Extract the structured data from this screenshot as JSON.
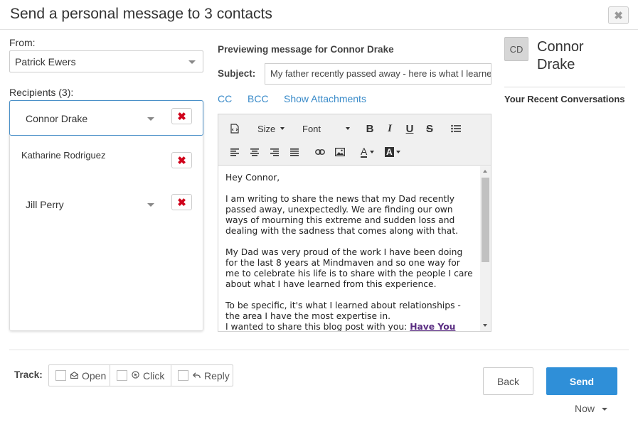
{
  "dialog": {
    "title": "Send a personal message to 3 contacts",
    "close_symbol": "✖"
  },
  "from": {
    "label": "From:",
    "value": "Patrick Ewers"
  },
  "recipients": {
    "label": "Recipients (3):",
    "items": [
      {
        "name": "Connor Drake"
      },
      {
        "name": "Katharine Rodriguez"
      },
      {
        "name": "Jill Perry"
      }
    ],
    "remove_symbol": "✖"
  },
  "preview": {
    "heading": "Previewing message for Connor Drake",
    "subject_label": "Subject:",
    "subject_value": "My father recently passed away - here is what I learned",
    "links": {
      "cc": "CC",
      "bcc": "BCC",
      "attachments": "Show Attachments"
    }
  },
  "toolbar": {
    "size_label": "Size",
    "font_label": "Font",
    "bold": "B",
    "italic": "I",
    "underline": "U",
    "strike": "S",
    "font_color": "A",
    "bg_color": "A"
  },
  "message": {
    "greeting": "Hey Connor,",
    "paragraph1": "I am writing to share the news that my Dad recently passed away, unexpectedly. We are finding our own ways of mourning this extreme and sudden loss and dealing with the sadness that comes along with that.",
    "paragraph2": "My Dad was very proud of the work I have been doing for the last 8 years at Mindmaven and so one way for me to celebrate his life is to share with the people I care about what I have learned from this experience.",
    "paragraph3_line1": "To be specific, it's what I learned about relationships - the area I have the most expertise in.",
    "paragraph3_line2": "I wanted to share this blog post with you: ",
    "blog_link": "Have You Said"
  },
  "contact": {
    "initials": "CD",
    "name": "Connor Drake",
    "recent_label": "Your Recent Conversations"
  },
  "tracking": {
    "label": "Track:",
    "options": [
      {
        "label": "Open"
      },
      {
        "label": "Click"
      },
      {
        "label": "Reply"
      }
    ]
  },
  "footer": {
    "back_label": "Back",
    "send_label": "Send",
    "schedule_label": "Now"
  },
  "colors": {
    "accent": "#2f8fd8",
    "link": "#3a8bc9",
    "remove": "#d0021b",
    "blog_link": "#5a2d82"
  }
}
